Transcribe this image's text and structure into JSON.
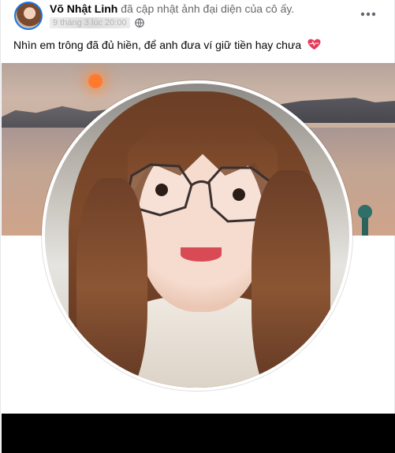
{
  "post": {
    "author_name": "Võ Nhật Linh",
    "action_text": "đã cập nhật ảnh đại diện của cô ấy.",
    "timestamp_blurred": "9 tháng 3 lúc 20:00",
    "privacy_icon": "globe-icon",
    "more_icon": "more-options-icon",
    "caption": "Nhìn em trông đã đủ hiền, để anh đưa ví giữ tiền hay chưa",
    "caption_emoji": "heart-pulse-emoji"
  },
  "colors": {
    "avatar_ring": "#1b74e4",
    "secondary_text": "#65676b",
    "primary_text": "#050505",
    "emoji_heart": "#e8395a"
  }
}
